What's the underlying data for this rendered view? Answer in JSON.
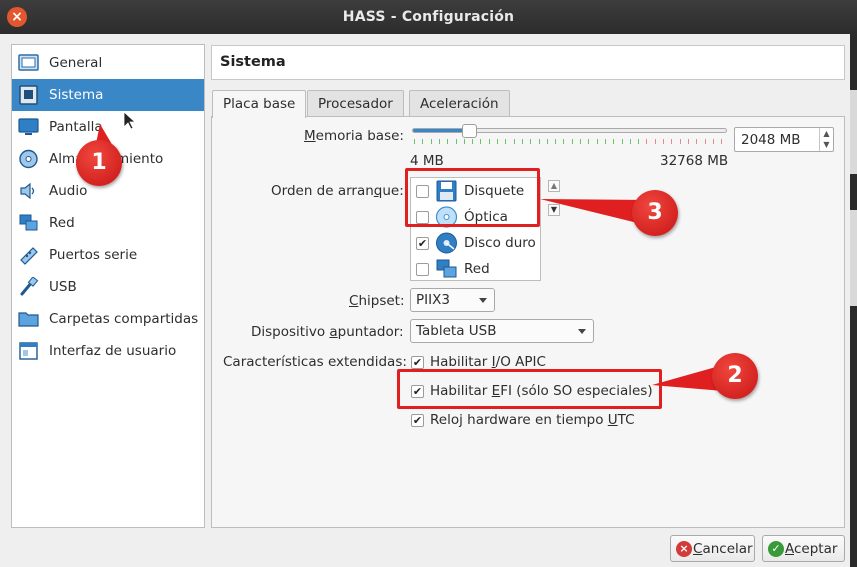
{
  "window": {
    "title": "HASS - Configuración",
    "close_glyph": "×"
  },
  "sidebar": {
    "items": [
      {
        "label": "General",
        "icon": "general-icon"
      },
      {
        "label": "Sistema",
        "icon": "system-icon",
        "selected": true
      },
      {
        "label": "Pantalla",
        "icon": "display-icon"
      },
      {
        "label": "Almacenamiento",
        "icon": "storage-icon"
      },
      {
        "label": "Audio",
        "icon": "audio-icon"
      },
      {
        "label": "Red",
        "icon": "network-icon"
      },
      {
        "label": "Puertos serie",
        "icon": "serial-ports-icon"
      },
      {
        "label": "USB",
        "icon": "usb-icon"
      },
      {
        "label": "Carpetas compartidas",
        "icon": "shared-folders-icon"
      },
      {
        "label": "Interfaz de usuario",
        "icon": "user-interface-icon"
      }
    ]
  },
  "section": {
    "title": "Sistema"
  },
  "tabs": [
    {
      "label": "Placa base",
      "active": true
    },
    {
      "label": "Procesador"
    },
    {
      "label": "Aceleración"
    }
  ],
  "motherboard": {
    "base_memory": {
      "label_pre": "M",
      "label_rest": "emoria base:",
      "min_label": "4 MB",
      "max_label": "32768 MB",
      "value": "2048 MB",
      "value_mb": 2048,
      "min_mb": 4,
      "max_mb": 32768
    },
    "boot_order": {
      "label_pre": "Orden de arran",
      "label_u": "q",
      "label_post": "ue:",
      "items": [
        {
          "label": "Disquete",
          "checked": false,
          "icon": "floppy-icon"
        },
        {
          "label": "Óptica",
          "checked": false,
          "icon": "optical-disc-icon"
        },
        {
          "label": "Disco duro",
          "checked": true,
          "icon": "hard-disk-icon"
        },
        {
          "label": "Red",
          "checked": false,
          "icon": "network-boot-icon"
        }
      ]
    },
    "chipset": {
      "label_u": "C",
      "label_rest": "hipset:",
      "value": "PIIX3"
    },
    "pointing_device": {
      "label_pre": "Dispositivo ",
      "label_u": "a",
      "label_rest": "puntador:",
      "value": "Tableta USB"
    },
    "extended_features": {
      "label": "Características extendidas:",
      "items": [
        {
          "pre": "Habilitar ",
          "u": "I",
          "post": "/O APIC",
          "checked": true
        },
        {
          "pre": "Habilitar ",
          "u": "E",
          "post": "FI (sólo SO especiales)",
          "checked": true
        },
        {
          "pre": "Reloj hardware en tiempo ",
          "u": "U",
          "post": "TC",
          "checked": true
        }
      ]
    }
  },
  "annotations": {
    "badge1": "1",
    "badge2": "2",
    "badge3": "3"
  },
  "buttons": {
    "cancel": {
      "label_u": "C",
      "label_rest": "ancelar"
    },
    "accept": {
      "label_u": "A",
      "label_rest": "ceptar"
    }
  },
  "colors": {
    "accent": "#3a87c8",
    "annotation_red": "#e02020",
    "checkmark": "✔"
  }
}
